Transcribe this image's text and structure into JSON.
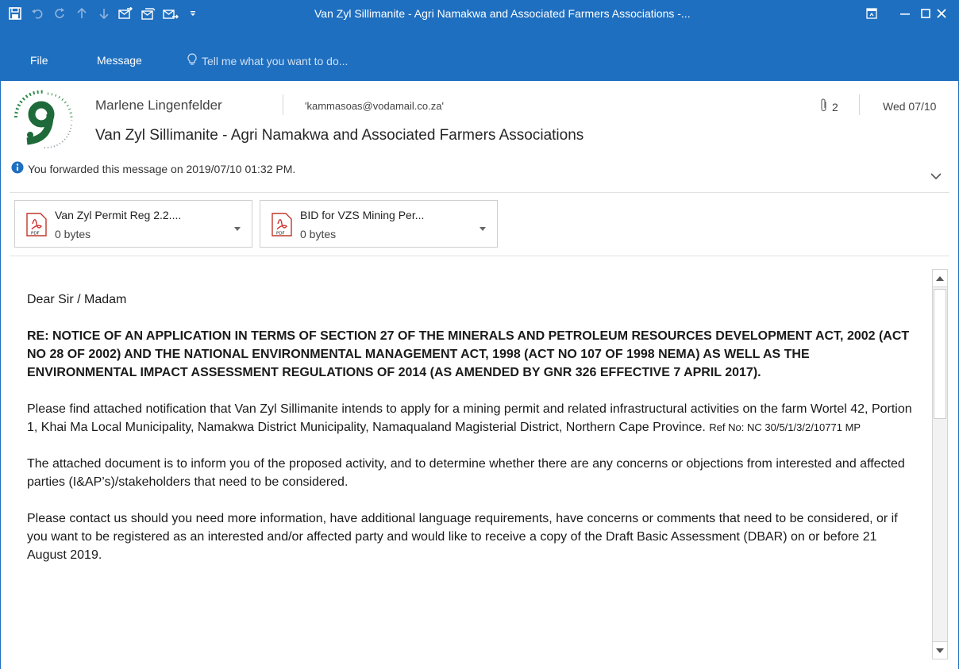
{
  "window": {
    "title": "Van Zyl Sillimanite - Agri Namakwa and Associated Farmers Associations -...",
    "accent_color": "#1e6fc0"
  },
  "ribbon": {
    "tabs": [
      "File",
      "Message"
    ],
    "tell_me_placeholder": "Tell me what you want to do..."
  },
  "header": {
    "sender": "Marlene Lingenfelder",
    "email": "'kammasoas@vodamail.co.za'",
    "attachment_count": "2",
    "date": "Wed 07/10",
    "subject": "Van Zyl Sillimanite - Agri Namakwa and Associated Farmers Associations",
    "info": "You forwarded this message on 2019/07/10 01:32 PM."
  },
  "attachments": [
    {
      "name": "Van Zyl Permit Reg 2.2....",
      "size": "0 bytes",
      "icon": "pdf-icon"
    },
    {
      "name": "BID for VZS Mining Per...",
      "size": "0 bytes",
      "icon": "pdf-icon"
    }
  ],
  "body": {
    "greeting": "Dear Sir / Madam",
    "re": "RE: NOTICE OF AN APPLICATION IN TERMS OF SECTION 27 OF THE MINERALS AND PETROLEUM RESOURCES DEVELOPMENT ACT, 2002 (ACT NO 28 OF 2002) AND THE NATIONAL ENVIRONMENTAL MANAGEMENT ACT, 1998 (ACT NO 107 OF 1998 NEMA) AS WELL AS THE ENVIRONMENTAL IMPACT ASSESSMENT REGULATIONS OF 2014 (AS AMENDED BY GNR 326 EFFECTIVE 7 APRIL 2017).",
    "p1": "Please find attached notification that Van Zyl Sillimanite intends to apply for a mining permit and related infrastructural activities on the farm Wortel 42, Portion 1, Khai Ma Local Municipality, Namakwa District Municipality, Namaqualand Magisterial District, Northern Cape Province.",
    "p1_ref": "Ref No: NC 30/5/1/3/2/10771 MP",
    "p2": "The attached document is to inform you of the proposed activity, and to determine whether there are any concerns or objections from interested and affected parties (I&AP’s)/stakeholders that need to be considered.",
    "p3": "Please contact us should you need more information, have additional language requirements, have concerns or comments that need to be considered, or if you want to be registered as an interested and/or affected party and would like to receive a copy of the Draft Basic Assessment (DBAR) on or before 21 August 2019."
  }
}
